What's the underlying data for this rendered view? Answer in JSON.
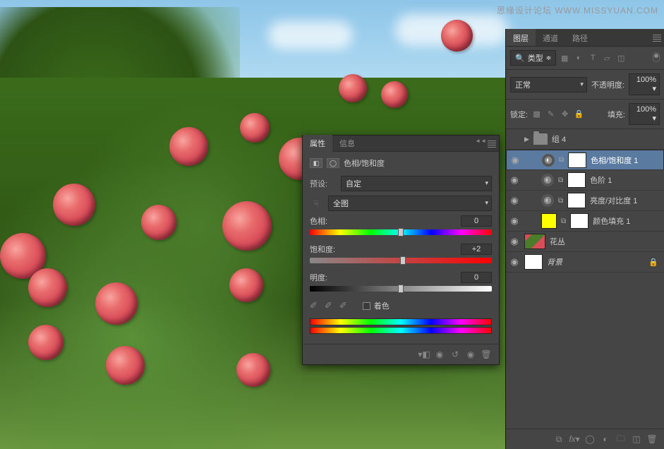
{
  "watermark": "思缘设计论坛  WWW.MISSYUAN.COM",
  "props_panel": {
    "tabs": {
      "properties": "属性",
      "info": "信息"
    },
    "adjustment_title": "色相/饱和度",
    "preset_label": "预设:",
    "preset_value": "自定",
    "channel_value": "全图",
    "sliders": {
      "hue": {
        "label": "色相:",
        "value": "0"
      },
      "saturation": {
        "label": "饱和度:",
        "value": "+2"
      },
      "lightness": {
        "label": "明度:",
        "value": "0"
      }
    },
    "colorize_label": "着色"
  },
  "layers_panel": {
    "tabs": {
      "layers": "图层",
      "channels": "通道",
      "paths": "路径"
    },
    "type_filter": "类型",
    "blend_mode": "正常",
    "opacity_label": "不透明度:",
    "opacity_value": "100%",
    "lock_label": "锁定:",
    "fill_label": "填充:",
    "fill_value": "100%",
    "layers": [
      {
        "name": "组 4"
      },
      {
        "name": "色相/饱和度 1"
      },
      {
        "name": "色阶 1"
      },
      {
        "name": "亮度/对比度 1"
      },
      {
        "name": "颜色填充 1"
      },
      {
        "name": "花丛"
      },
      {
        "name": "背景"
      }
    ]
  }
}
